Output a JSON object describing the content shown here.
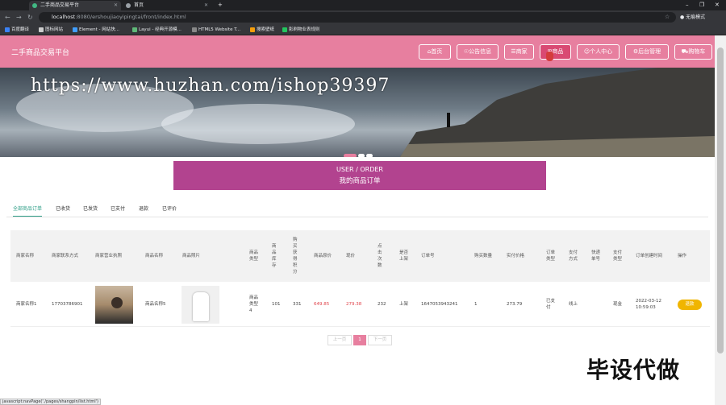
{
  "browser": {
    "tabs": [
      {
        "label": "二手商品交易平台",
        "active": true
      },
      {
        "label": "首页",
        "active": false
      }
    ],
    "new_tab": "+",
    "url_host": "localhost",
    "url_rest": ":8080/ershoujiaoyipingtai/front/index.html",
    "profile": "无痕模式",
    "bookmarks": [
      "百度翻译",
      "图标网站",
      "Element - 网站快...",
      "Layui - 经典开源模...",
      "HTML5 Website T...",
      "搜索壁纸",
      "影刷物业表规则"
    ]
  },
  "header": {
    "brand": "二手商品交易平台",
    "nav": [
      {
        "label": "首页",
        "active": false
      },
      {
        "label": "公告信息",
        "active": false
      },
      {
        "label": "商家",
        "active": false
      },
      {
        "label": "商品",
        "active": true
      },
      {
        "label": "个人中心",
        "active": false
      },
      {
        "label": "后台管理",
        "active": false
      },
      {
        "label": "购物车",
        "active": false
      }
    ]
  },
  "banner": {
    "watermark": "https://www.huzhan.com/ishop39397",
    "slides": 3,
    "active_slide": 1
  },
  "page_title": {
    "en": "USER / ORDER",
    "cn": "我的商品订单"
  },
  "order_tabs": [
    {
      "label": "全部商品订单",
      "active": true
    },
    {
      "label": "已收货",
      "active": false
    },
    {
      "label": "已发货",
      "active": false
    },
    {
      "label": "已支付",
      "active": false
    },
    {
      "label": "退款",
      "active": false
    },
    {
      "label": "已评价",
      "active": false
    }
  ],
  "table": {
    "headers": [
      "商家名称",
      "商家联系方式",
      "商家营业执照",
      "商品名称",
      "商品照片",
      "商品类型",
      "商品库存",
      "购买获得积分",
      "商品原价",
      "现价",
      "点击次数",
      "是否上架",
      "订单号",
      "购买数量",
      "实付价格",
      "订单类型",
      "支付方式",
      "快递单号",
      "支付类型",
      "订单创建时间",
      "操作"
    ],
    "rows": [
      {
        "merchant": "商家名称1",
        "phone": "17703786901",
        "product": "商品名称5",
        "type": "商品类型4",
        "stock": "101",
        "points": "331",
        "orig_price": "649.85",
        "price": "279.38",
        "clicks": "232",
        "on_shelf": "上架",
        "order_no": "1647053943241",
        "qty": "1",
        "paid": "273.79",
        "order_type": "已支付",
        "pay_method": "线上",
        "express": "",
        "pay_type": "现金",
        "created": "2022-03-12 10:59:03",
        "action": "退款"
      }
    ]
  },
  "pager": {
    "prev": "上一页",
    "current": "1",
    "next": "下一页"
  },
  "overlay_text": "毕设代做",
  "status_url": "javascript:navPage('./pages/shangpin/list.html')"
}
